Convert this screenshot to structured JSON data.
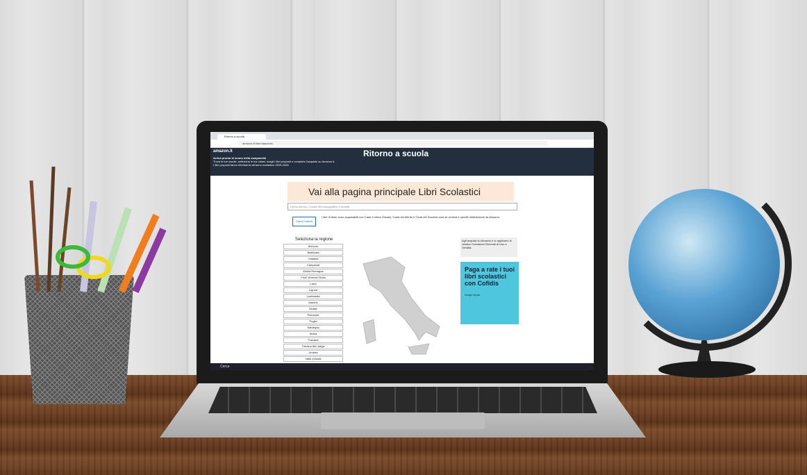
{
  "browser": {
    "tab_title": "Ritorno a scuola",
    "url": "amazon.it/ritornoascuola"
  },
  "header": {
    "logo": "amazon.it",
    "title": "Ritorno a scuola",
    "sub_line1": "Arriva pronto al suono della campanella",
    "sub_line2": "Trova le tue scuole, seleziona le tue classi, scegli i libri proposti e completa l'acquisto su Amazon.it.",
    "sub_line3": "I libri proposti fanno riferimento all'anno scolastico 2025-2026."
  },
  "banner": {
    "title": "Vai alla pagina principale Libri Scolastici"
  },
  "search": {
    "placeholder": "Cerca Ateneo, Codice Meccanografico o località"
  },
  "info": {
    "badge": "Carta Cultura",
    "text": "I libri di testo sono acquistabili con Carta Cultura Giovani, Carta del Merito e Carta del Docente solo se venduti e spediti direttamente da Amazon."
  },
  "regions": {
    "title": "Seleziona la regione",
    "items": [
      "Abruzzo",
      "Basilicata",
      "Calabria",
      "Campania",
      "Emilia Romagna",
      "Friuli Venezia Giulia",
      "Lazio",
      "Liguria",
      "Lombardia",
      "Marche",
      "Molise",
      "Piemonte",
      "Puglia",
      "Sardegna",
      "Sicilia",
      "Toscana",
      "Trentino Alto Adige",
      "Umbria",
      "Valle d'Aosta"
    ]
  },
  "note": {
    "text": "Agli acquisti su Amazon.it si applicano le relative Condizioni Generali di Uso e Vendita."
  },
  "ad": {
    "title": "Paga a rate i tuoi libri scolastici con Cofidis",
    "link": "Scopri di più"
  },
  "taskbar": {
    "search": "Cerca"
  }
}
